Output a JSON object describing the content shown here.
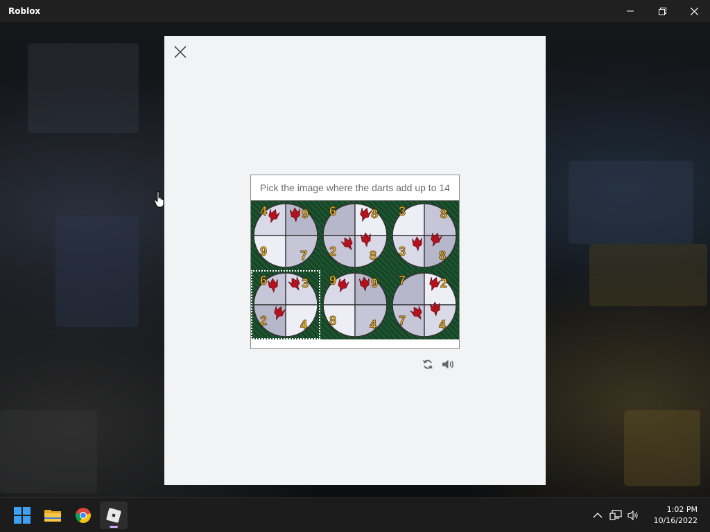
{
  "window": {
    "title": "Roblox",
    "controls": [
      "minimize-icon",
      "restore-icon",
      "close-icon"
    ]
  },
  "modal": {
    "close_icon": "close-icon",
    "captcha": {
      "prompt": "Pick the image where the darts add up to 14",
      "tiles": [
        {
          "numbers": [
            "4",
            "9",
            "9",
            "7"
          ],
          "selected": false
        },
        {
          "numbers": [
            "6",
            "8",
            "2",
            "8"
          ],
          "selected": false
        },
        {
          "numbers": [
            "3",
            "8",
            "3",
            "8"
          ],
          "selected": false
        },
        {
          "numbers": [
            "6",
            "3",
            "2",
            "4"
          ],
          "selected": true
        },
        {
          "numbers": [
            "9",
            "9",
            "8",
            "4"
          ],
          "selected": false
        },
        {
          "numbers": [
            "7",
            "2",
            "7",
            "4"
          ],
          "selected": false
        }
      ],
      "tools": [
        "refresh-icon",
        "audio-icon"
      ]
    }
  },
  "taskbar": {
    "apps": [
      "windows-start-icon",
      "file-explorer-icon",
      "chrome-icon",
      "roblox-icon"
    ],
    "active_app": "roblox-icon",
    "tray_icons": [
      "chevron-up-icon",
      "network-icon",
      "volume-icon"
    ],
    "time": "1:02 PM",
    "date": "10/16/2022"
  },
  "colors": {
    "modal_bg": "#f2f3f5",
    "tile_bg": "#1d5530",
    "dart": "#b3121e",
    "number": "#f0b22b",
    "taskbar_bg": "#1c1c1c",
    "active_indicator": "#c8a6f5"
  }
}
